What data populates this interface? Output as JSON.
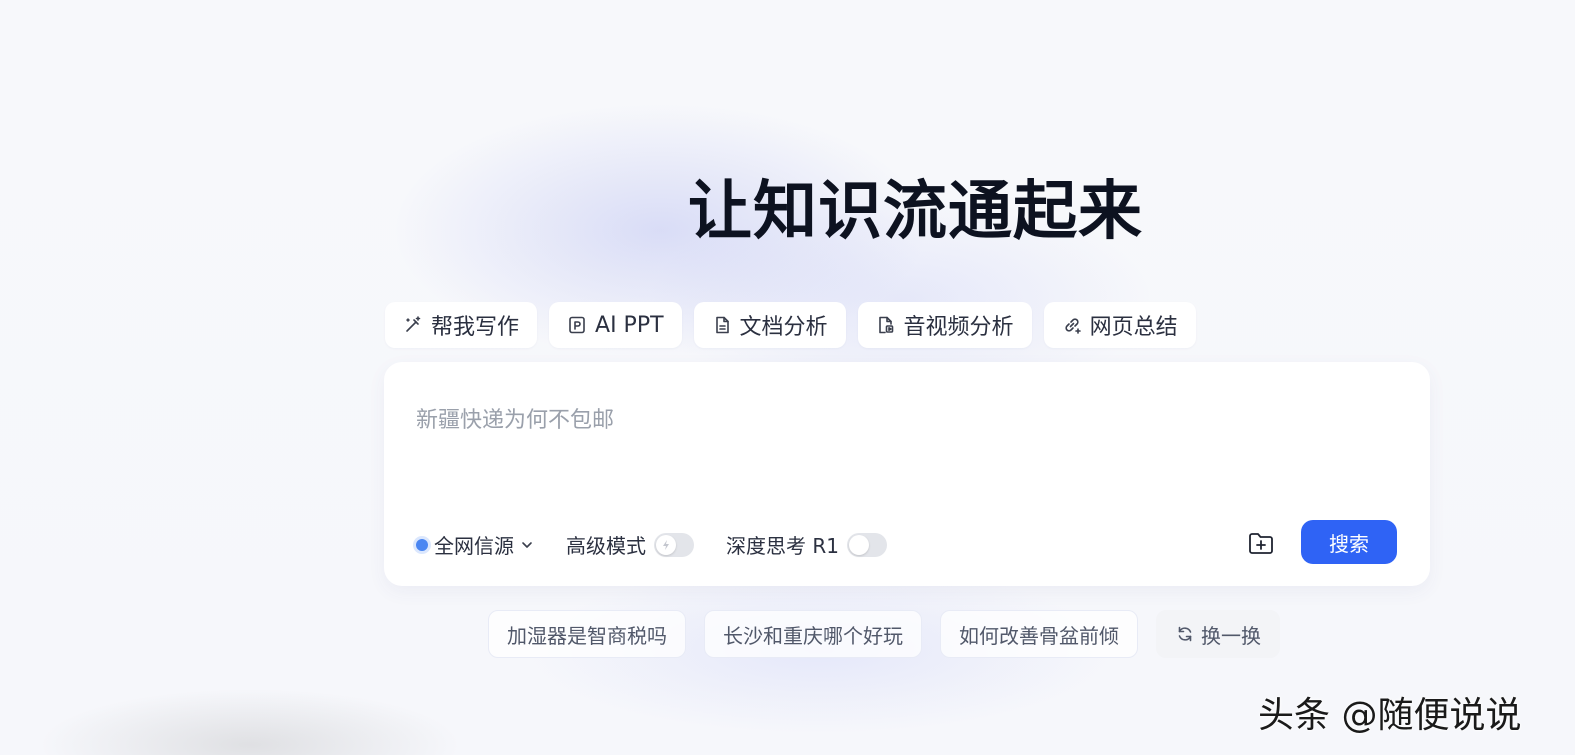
{
  "title": "让知识流通起来",
  "tools": [
    {
      "label": "帮我写作",
      "icon": "magic-pen-icon"
    },
    {
      "label": "AI PPT",
      "icon": "ppt-file-icon"
    },
    {
      "label": "文档分析",
      "icon": "document-icon"
    },
    {
      "label": "音视频分析",
      "icon": "media-file-icon"
    },
    {
      "label": "网页总结",
      "icon": "link-icon"
    }
  ],
  "search": {
    "placeholder": "新疆快递为何不包邮",
    "source_label": "全网信源",
    "advanced_mode_label": "高级模式",
    "deep_think_label": "深度思考 R1",
    "advanced_mode_on": false,
    "deep_think_on": false,
    "submit_label": "搜索"
  },
  "suggestions": [
    "加湿器是智商税吗",
    "长沙和重庆哪个好玩",
    "如何改善骨盆前倾"
  ],
  "refresh_label": "换一换",
  "watermark": "头条 @随便说说",
  "colors": {
    "accent": "#2f63f5",
    "title": "#0d1220",
    "placeholder": "#9aa0ab",
    "source_dot": "#4a86f2"
  }
}
